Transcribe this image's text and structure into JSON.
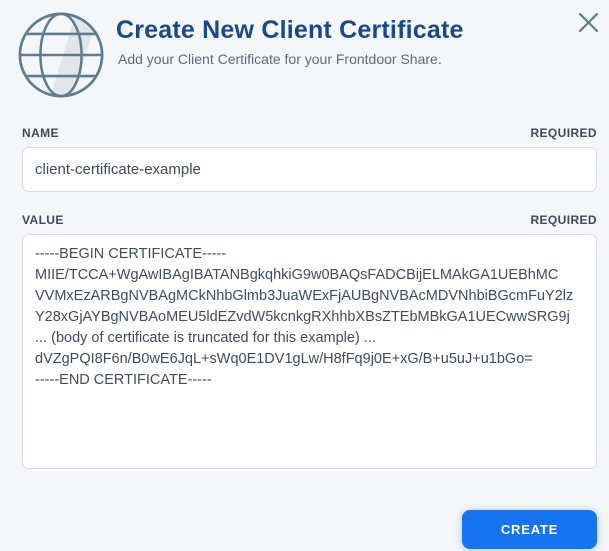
{
  "modal": {
    "title": "Create New Client Certificate",
    "subtitle": "Add your Client Certificate for your Frontdoor Share."
  },
  "icons": {
    "globe": "globe-icon",
    "close": "close-icon"
  },
  "name_field": {
    "label": "NAME",
    "required_badge": "REQUIRED",
    "value": "client-certificate-example"
  },
  "value_field": {
    "label": "VALUE",
    "required_badge": "REQUIRED",
    "value": "-----BEGIN CERTIFICATE-----\nMIIE/TCCA+WgAwIBAgIBATANBgkqhkiG9w0BAQsFADCBijELMAkGA1UEBhMC\nVVMxEzARBgNVBAgMCkNhbGlmb3JuaWExFjAUBgNVBAcMDVNhbiBGcmFuY2lz\nY28xGjAYBgNVBAoMEU5ldEZvdW5kcnkgRXhhbXBsZTEbMBkGA1UECwwSRG9j\n... (body of certificate is truncated for this example) ...\ndVZgPQI8F6n/B0wE6JqL+sWq0E1DV1gLw/H8fFq9j0E+xG/B+u5uJ+u1bGo=\n-----END CERTIFICATE-----"
  },
  "footer": {
    "create_label": "CREATE"
  },
  "colors": {
    "background": "#f4f6fa",
    "title_blue": "#174a8c",
    "accent_blue": "#1674f1",
    "icon_stroke": "#5d7d93",
    "field_border": "#d8dce5"
  }
}
